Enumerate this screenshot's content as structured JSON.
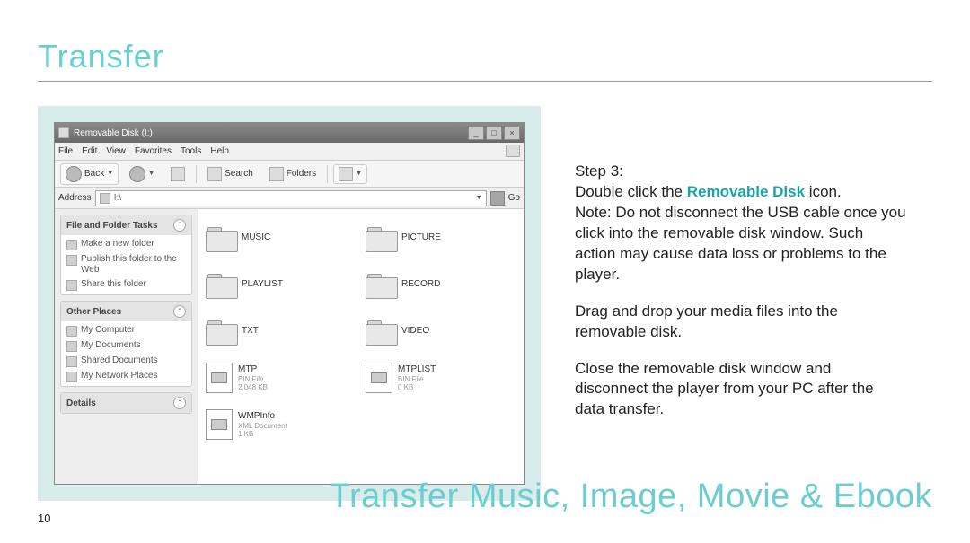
{
  "page": {
    "title": "Transfer",
    "bigTitle": "Transfer Music, Image, Movie & Ebook",
    "number": "10"
  },
  "instructions": {
    "step": "Step 3:",
    "line1a": "Double click the ",
    "line1b": "Removable Disk",
    "line1c": " icon.",
    "note": "Note: Do not disconnect the USB cable once you click into the removable disk window. Such action may cause data loss or problems to the player.",
    "p2": "Drag and drop your media files into the removable disk.",
    "p3": "Close the removable disk window and disconnect the player from your PC after the data transfer."
  },
  "window": {
    "title": "Removable Disk (I:)",
    "menus": [
      "File",
      "Edit",
      "View",
      "Favorites",
      "Tools",
      "Help"
    ],
    "toolbar": {
      "back": "Back",
      "search": "Search",
      "folders": "Folders"
    },
    "address": {
      "label": "Address",
      "value": "I:\\",
      "go": "Go"
    },
    "sidebar": {
      "panel1": {
        "title": "File and Folder Tasks",
        "items": [
          "Make a new folder",
          "Publish this folder to the Web",
          "Share this folder"
        ]
      },
      "panel2": {
        "title": "Other Places",
        "items": [
          "My Computer",
          "My Documents",
          "Shared Documents",
          "My Network Places"
        ]
      },
      "panel3": {
        "title": "Details"
      }
    },
    "items": [
      {
        "name": "MUSIC",
        "type": "folder"
      },
      {
        "name": "PICTURE",
        "type": "folder"
      },
      {
        "name": "PLAYLIST",
        "type": "folder"
      },
      {
        "name": "RECORD",
        "type": "folder"
      },
      {
        "name": "TXT",
        "type": "folder"
      },
      {
        "name": "VIDEO",
        "type": "folder"
      },
      {
        "name": "MTP",
        "type": "file",
        "meta1": "BIN File",
        "meta2": "2,048 KB"
      },
      {
        "name": "MTPLIST",
        "type": "file",
        "meta1": "BIN File",
        "meta2": "0 KB"
      },
      {
        "name": "WMPInfo",
        "type": "file",
        "meta1": "XML Document",
        "meta2": "1 KB"
      }
    ]
  }
}
